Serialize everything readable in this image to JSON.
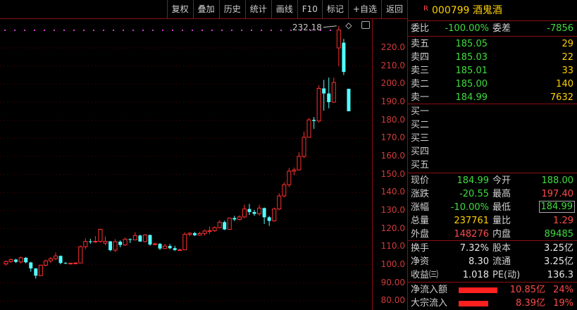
{
  "toolbar": [
    "复权",
    "叠加",
    "历史",
    "统计",
    "画线",
    "F10",
    "标记",
    "+自选",
    "返回"
  ],
  "header": {
    "badge": "R",
    "code_name": "000799 酒鬼酒"
  },
  "chart": {
    "y_labels": [
      "220.0",
      "210.0",
      "200.0",
      "190.0",
      "180.0",
      "170.0",
      "160.0",
      "150.0",
      "140.0",
      "130.0",
      "120.0",
      "110.0",
      "100.0",
      "90.00",
      "80.00"
    ],
    "high_marker": "232.18"
  },
  "chart_data": {
    "type": "candlestick",
    "ylim": [
      75,
      236
    ],
    "candles": [
      [
        100.5,
        101.8,
        99.6,
        102.4
      ],
      [
        101.8,
        102.9,
        101.1,
        103.5
      ],
      [
        102.9,
        101.6,
        101.0,
        103.3
      ],
      [
        101.6,
        103.9,
        100.7,
        104.6
      ],
      [
        103.9,
        101.4,
        100.8,
        104.3
      ],
      [
        101.3,
        98.0,
        96.2,
        101.7
      ],
      [
        98.0,
        94.0,
        92.4,
        98.2
      ],
      [
        94.0,
        99.8,
        93.8,
        100.1
      ],
      [
        99.8,
        102.2,
        99.2,
        102.8
      ],
      [
        102.2,
        103.4,
        101.0,
        104.3
      ],
      [
        103.4,
        104.9,
        102.6,
        106.8
      ],
      [
        104.9,
        101.0,
        100.3,
        105.2
      ],
      [
        101.0,
        100.9,
        100.5,
        101.5
      ],
      [
        100.9,
        100.9,
        100.1,
        101.1
      ],
      [
        100.9,
        101.0,
        100.3,
        101.4
      ],
      [
        101.0,
        110.0,
        100.9,
        110.7
      ],
      [
        110.0,
        113.0,
        108.7,
        114.6
      ],
      [
        113.0,
        112.6,
        111.6,
        114.4
      ],
      [
        112.6,
        113.0,
        112.1,
        115.9
      ],
      [
        113.0,
        119.6,
        112.2,
        120.0
      ],
      [
        112.0,
        113.0,
        110.8,
        115.6
      ],
      [
        113.0,
        108.1,
        107.5,
        113.1
      ],
      [
        108.1,
        112.8,
        107.1,
        114.2
      ],
      [
        112.8,
        111.0,
        109.7,
        113.5
      ],
      [
        111.0,
        114.2,
        110.5,
        115.0
      ],
      [
        114.2,
        113.8,
        112.1,
        114.6
      ],
      [
        113.8,
        116.2,
        113.5,
        118.0
      ],
      [
        116.2,
        112.9,
        112.7,
        116.7
      ],
      [
        112.9,
        116.5,
        112.4,
        117.0
      ],
      [
        116.5,
        111.2,
        110.6,
        116.7
      ],
      [
        111.2,
        111.6,
        110.9,
        112.3
      ],
      [
        111.6,
        109.0,
        108.2,
        112.1
      ],
      [
        109.0,
        110.4,
        108.8,
        111.6
      ],
      [
        110.4,
        109.2,
        108.6,
        111.5
      ],
      [
        109.2,
        108.2,
        107.6,
        110.5
      ],
      [
        108.2,
        108.3,
        107.9,
        109.0
      ],
      [
        108.3,
        116.9,
        108.2,
        118.0
      ],
      [
        116.9,
        117.5,
        115.8,
        118.0
      ],
      [
        117.5,
        116.4,
        115.9,
        118.2
      ],
      [
        116.4,
        117.3,
        116.2,
        118.3
      ],
      [
        117.3,
        118.7,
        116.2,
        119.5
      ],
      [
        118.7,
        118.9,
        117.0,
        121.2
      ],
      [
        118.9,
        120.6,
        118.2,
        121.2
      ],
      [
        120.6,
        123.6,
        120.2,
        124.6
      ],
      [
        123.6,
        119.6,
        119.2,
        124.4
      ],
      [
        119.6,
        125.9,
        119.6,
        126.1
      ],
      [
        125.9,
        125.1,
        124.2,
        127.1
      ],
      [
        125.1,
        126.5,
        124.6,
        127.4
      ],
      [
        126.5,
        130.9,
        125.8,
        133.3
      ],
      [
        130.9,
        129.2,
        127.6,
        133.7
      ],
      [
        129.2,
        128.2,
        127.1,
        130.4
      ],
      [
        128.2,
        131.4,
        127.1,
        133.2
      ],
      [
        131.4,
        126.3,
        122.6,
        131.7
      ],
      [
        126.3,
        124.3,
        121.5,
        127.1
      ],
      [
        124.3,
        130.9,
        123.8,
        131.7
      ],
      [
        130.9,
        138.1,
        130.4,
        139.6
      ],
      [
        138.1,
        144.3,
        137.4,
        145.7
      ],
      [
        144.3,
        151.8,
        143.0,
        153.6
      ],
      [
        151.8,
        152.5,
        149.5,
        153.8
      ],
      [
        152.5,
        160.0,
        152.2,
        162.3
      ],
      [
        160.0,
        170.6,
        159.0,
        173.7
      ],
      [
        170.6,
        180.2,
        170.4,
        181.2
      ],
      [
        180.2,
        179.6,
        175.2,
        181.8
      ],
      [
        179.6,
        197.6,
        178.8,
        199.4
      ],
      [
        197.6,
        194.8,
        185.3,
        202.3
      ],
      [
        194.8,
        190.0,
        186.6,
        203.6
      ],
      [
        190.0,
        200.9,
        189.6,
        203.5
      ],
      [
        220.0,
        230.0,
        210.0,
        232.18
      ],
      [
        222.9,
        206.7,
        205.0,
        225.0
      ],
      [
        197.4,
        184.99,
        184.99,
        197.4
      ]
    ]
  },
  "quote": {
    "weibi": {
      "label": "委比",
      "value": "-100.00%",
      "label2": "委差",
      "value2": "-7856"
    },
    "asks": [
      {
        "label": "卖五",
        "price": "185.05",
        "vol": "29"
      },
      {
        "label": "卖四",
        "price": "185.03",
        "vol": "22"
      },
      {
        "label": "卖三",
        "price": "185.01",
        "vol": "33"
      },
      {
        "label": "卖二",
        "price": "185.00",
        "vol": "140"
      },
      {
        "label": "卖一",
        "price": "184.99",
        "vol": "7632"
      }
    ],
    "bids": [
      {
        "label": "买一"
      },
      {
        "label": "买二"
      },
      {
        "label": "买三"
      },
      {
        "label": "买四"
      },
      {
        "label": "买五"
      }
    ],
    "stats": [
      {
        "l1": "现价",
        "v1": "184.99",
        "l2": "今开",
        "v2": "188.00"
      },
      {
        "l1": "涨跌",
        "v1": "-20.55",
        "l2": "最高",
        "v2": "197.40"
      },
      {
        "l1": "涨幅",
        "v1": "-10.00%",
        "l2": "最低",
        "v2": "184.99"
      },
      {
        "l1": "总量",
        "v1": "237761",
        "l2": "量比",
        "v2": "1.29"
      },
      {
        "l1": "外盘",
        "v1": "148276",
        "l2": "内盘",
        "v2": "89485"
      }
    ],
    "fund": [
      {
        "l1": "换手",
        "v1": "7.32%",
        "l2": "股本",
        "v2": "3.25亿"
      },
      {
        "l1": "净资",
        "v1": "8.30",
        "l2": "流通",
        "v2": "3.25亿"
      },
      {
        "l1": "收益㈢",
        "v1": "1.018",
        "l2": "PE(动)",
        "v2": "136.3"
      }
    ],
    "flows": [
      {
        "label": "净流入额",
        "amount": "10.85亿",
        "pct": "24%"
      },
      {
        "label": "大宗流入",
        "amount": "8.39亿",
        "pct": "19%"
      }
    ]
  },
  "colors": {
    "up": "#ff3030",
    "down": "#54ffff",
    "panel_border": "#8a1010"
  }
}
